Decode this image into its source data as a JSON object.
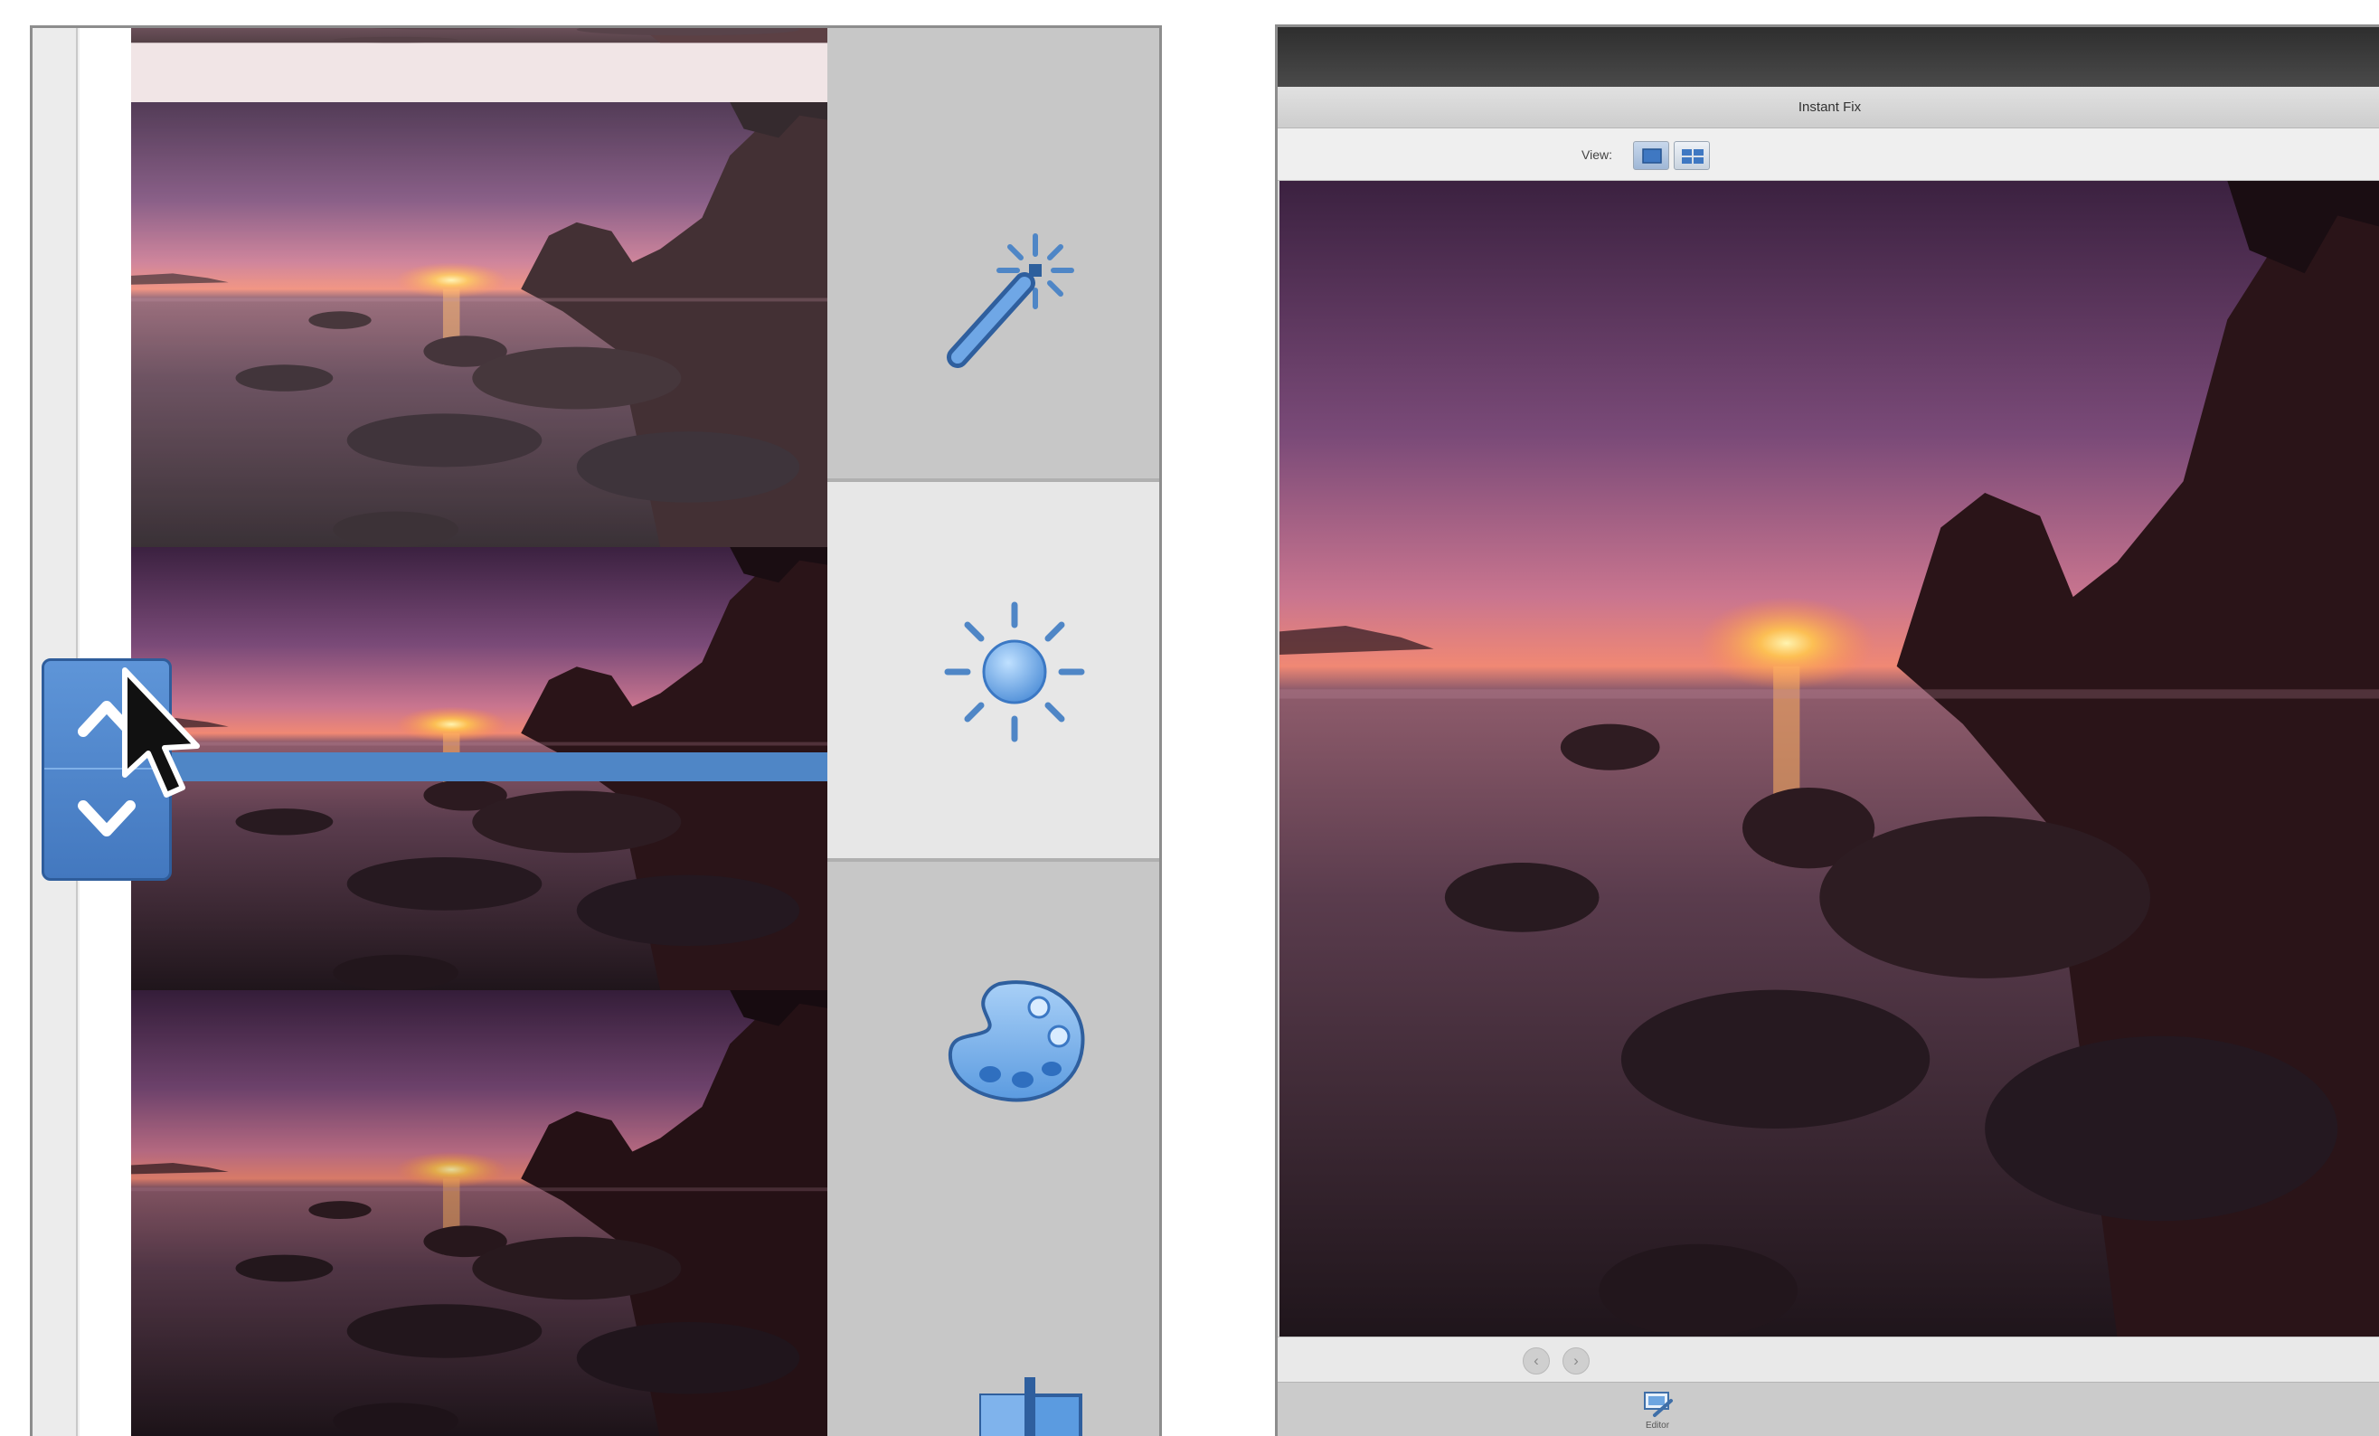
{
  "left_panel": {
    "thumbnails": [
      {
        "name": "partial-top"
      },
      {
        "name": "variation-1"
      },
      {
        "name": "variation-2"
      },
      {
        "name": "variation-3"
      }
    ],
    "tools": [
      "quick-fix-wand-icon",
      "lighting-sun-icon",
      "color-palette-icon",
      "balance-icon"
    ],
    "stepper": {
      "up_icon": "chevron-up-icon",
      "down_icon": "chevron-down-icon"
    }
  },
  "right_panel": {
    "title": "Instant Fix",
    "view_label": "View:",
    "view_buttons": [
      "single-view-icon",
      "split-view-icon"
    ],
    "nav": {
      "prev": "‹",
      "next": "›"
    },
    "bottom": {
      "editor_label": "Editor"
    }
  },
  "colors": {
    "accent_blue": "#4f86c6",
    "icon_blue": "#5b9be0",
    "panel_gray": "#c7c7c7",
    "selected_gray": "#e7e7e7"
  }
}
